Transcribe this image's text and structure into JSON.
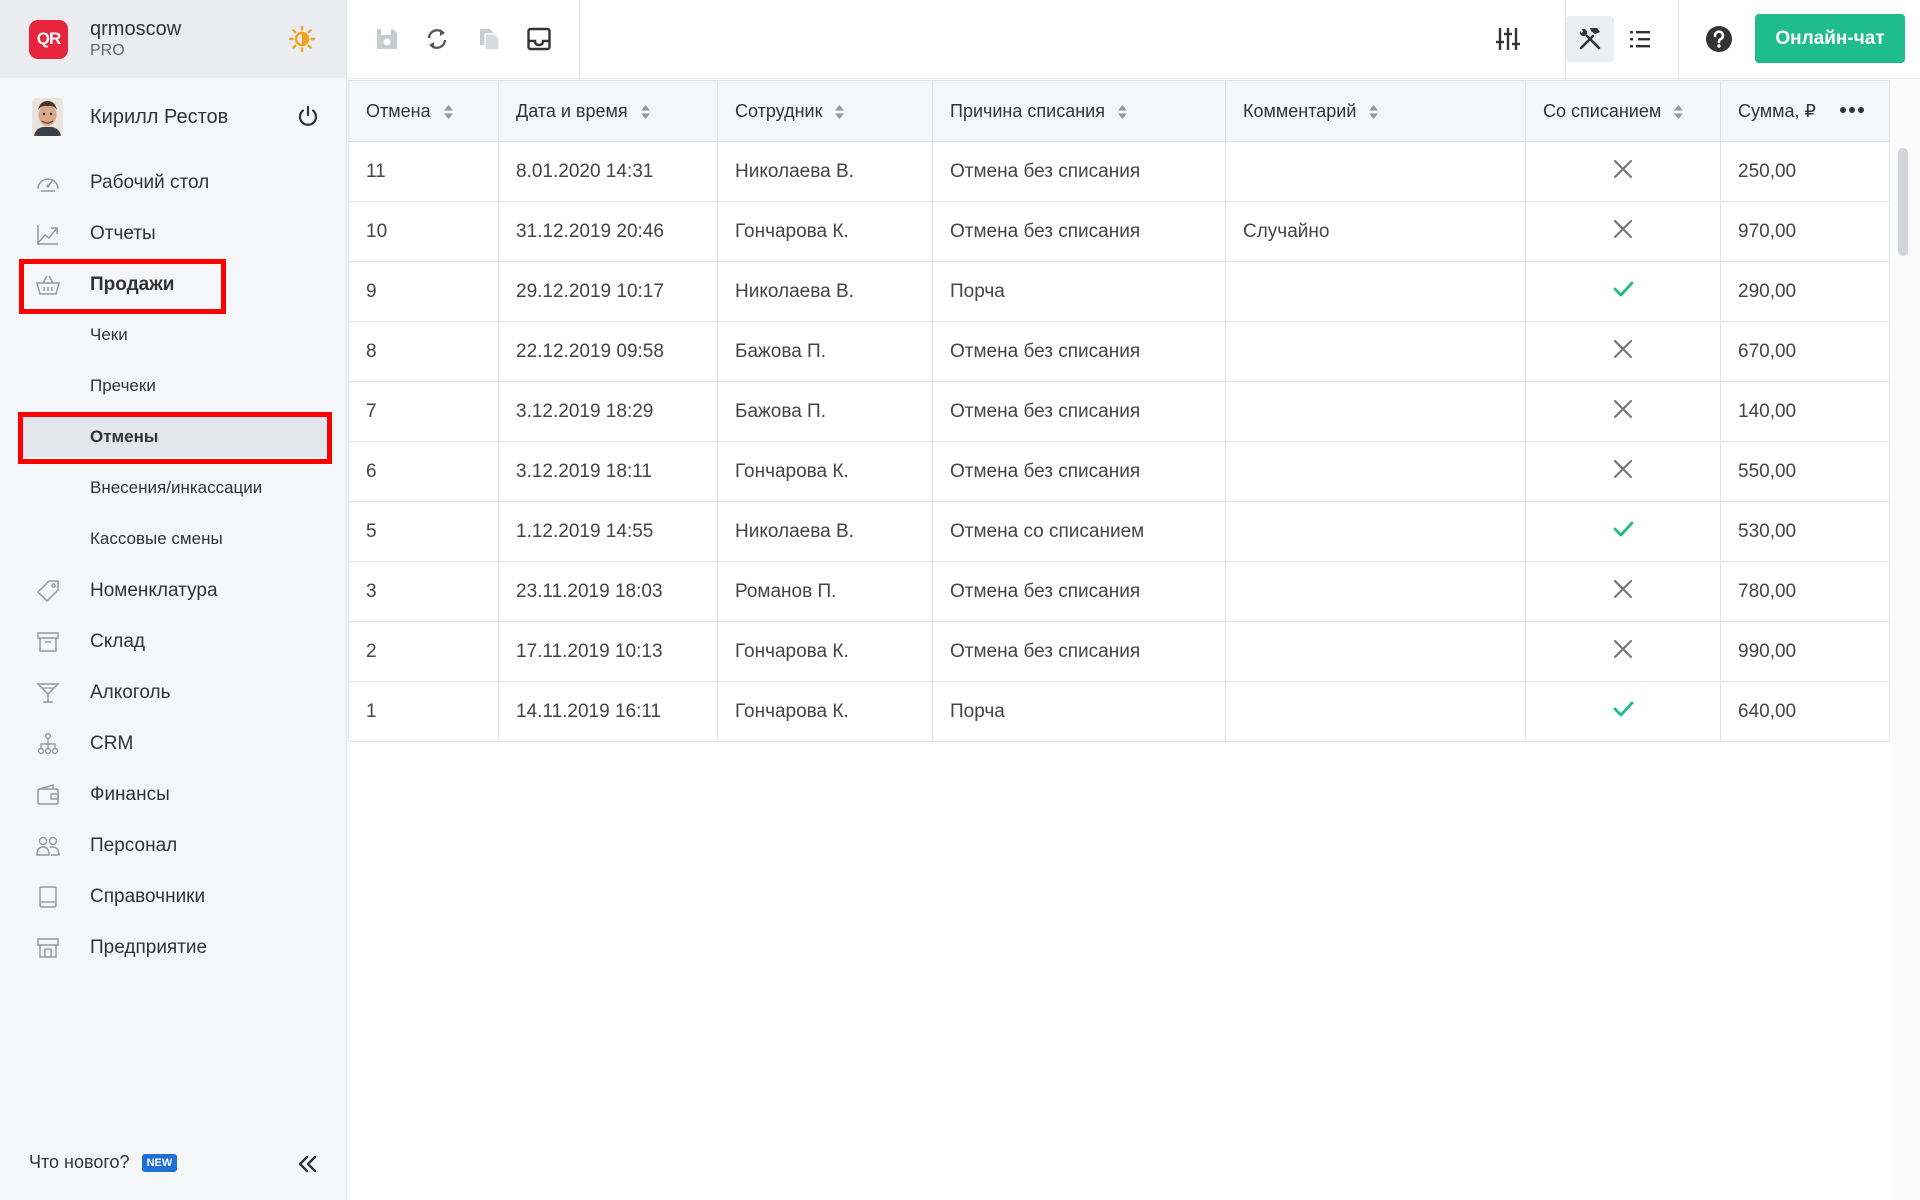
{
  "brand": {
    "logo_text": "QR",
    "name": "qrmoscow",
    "plan": "PRO"
  },
  "user": {
    "name": "Кирилл Рестов"
  },
  "nav": {
    "dashboard": "Рабочий стол",
    "reports": "Отчеты",
    "sales": "Продажи",
    "receipts": "Чеки",
    "prereceipts": "Пречеки",
    "cancellations": "Отмены",
    "cash_ops": "Внесения/инкассации",
    "shifts": "Кассовые смены",
    "nomenclature": "Номенклатура",
    "warehouse": "Склад",
    "alcohol": "Алкоголь",
    "crm": "CRM",
    "finance": "Финансы",
    "staff": "Персонал",
    "references": "Справочники",
    "enterprise": "Предприятие"
  },
  "footer": {
    "whats_new": "Что нового?",
    "new_badge": "NEW"
  },
  "toolbar": {
    "chat_label": "Онлайн-чат"
  },
  "colors": {
    "accent": "#1fbd8c",
    "brand": "#e8233c",
    "highlight": "#ff0000",
    "check": "#1fbd8c"
  },
  "table": {
    "columns": [
      "Отмена",
      "Дата и время",
      "Сотрудник",
      "Причина списания",
      "Комментарий",
      "Со списанием",
      "Сумма, ₽"
    ],
    "rows": [
      {
        "id": "11",
        "datetime": "8.01.2020 14:31",
        "employee": "Николаева В.",
        "reason": "Отмена без списания",
        "comment": "",
        "writeoff": false,
        "sum": "250,00"
      },
      {
        "id": "10",
        "datetime": "31.12.2019 20:46",
        "employee": "Гончарова К.",
        "reason": "Отмена без списания",
        "comment": "Случайно",
        "writeoff": false,
        "sum": "970,00"
      },
      {
        "id": "9",
        "datetime": "29.12.2019 10:17",
        "employee": "Николаева В.",
        "reason": "Порча",
        "comment": "",
        "writeoff": true,
        "sum": "290,00"
      },
      {
        "id": "8",
        "datetime": "22.12.2019 09:58",
        "employee": "Бажова П.",
        "reason": "Отмена без списания",
        "comment": "",
        "writeoff": false,
        "sum": "670,00"
      },
      {
        "id": "7",
        "datetime": "3.12.2019 18:29",
        "employee": "Бажова П.",
        "reason": "Отмена без списания",
        "comment": "",
        "writeoff": false,
        "sum": "140,00"
      },
      {
        "id": "6",
        "datetime": "3.12.2019 18:11",
        "employee": "Гончарова К.",
        "reason": "Отмена без списания",
        "comment": "",
        "writeoff": false,
        "sum": "550,00"
      },
      {
        "id": "5",
        "datetime": "1.12.2019 14:55",
        "employee": "Николаева В.",
        "reason": "Отмена со списанием",
        "comment": "",
        "writeoff": true,
        "sum": "530,00"
      },
      {
        "id": "3",
        "datetime": "23.11.2019 18:03",
        "employee": "Романов П.",
        "reason": "Отмена без списания",
        "comment": "",
        "writeoff": false,
        "sum": "780,00"
      },
      {
        "id": "2",
        "datetime": "17.11.2019 10:13",
        "employee": "Гончарова К.",
        "reason": "Отмена без списания",
        "comment": "",
        "writeoff": false,
        "sum": "990,00"
      },
      {
        "id": "1",
        "datetime": "14.11.2019 16:11",
        "employee": "Гончарова К.",
        "reason": "Порча",
        "comment": "",
        "writeoff": true,
        "sum": "640,00"
      }
    ]
  }
}
